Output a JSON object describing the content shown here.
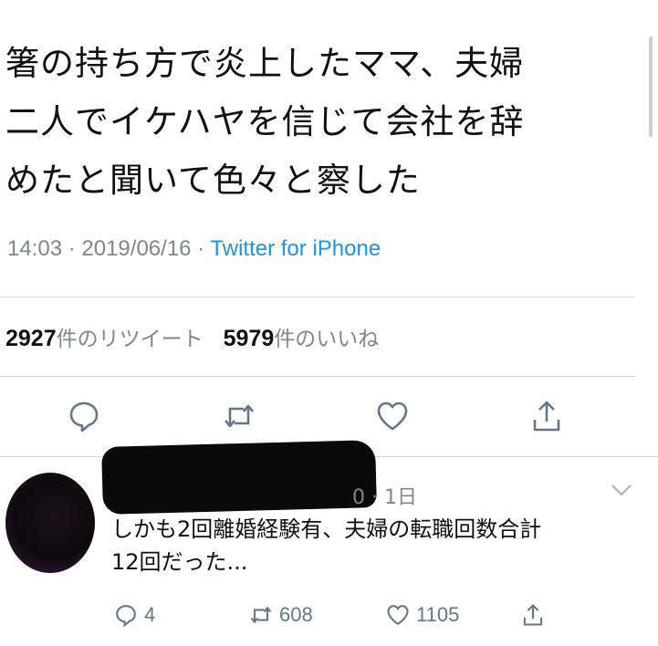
{
  "tweet": {
    "text": "箸の持ち方で炎上したママ、夫婦\n二人でイケハヤを信じて会社を辞\nめたと聞いて色々と察した",
    "time": "14:03",
    "separator": " · ",
    "date": "2019/06/16",
    "client": "Twitter for iPhone"
  },
  "stats": {
    "retweets_count": "2927",
    "retweets_label": "件のリツイート",
    "likes_count": "5979",
    "likes_label": "件のいいね"
  },
  "actions": [
    {
      "icon": "reply-icon"
    },
    {
      "icon": "retweet-icon"
    },
    {
      "icon": "heart-icon"
    },
    {
      "icon": "share-icon"
    }
  ],
  "reply": {
    "time_partial": "0 · 1日",
    "text": "しかも2回離婚経験有、夫婦の転職回数合計\n12回だった...",
    "reply_count": "4",
    "retweet_count": "608",
    "like_count": "1105"
  },
  "colors": {
    "link": "#1b95e0",
    "muted": "#7d8790",
    "icon": "#657786"
  }
}
